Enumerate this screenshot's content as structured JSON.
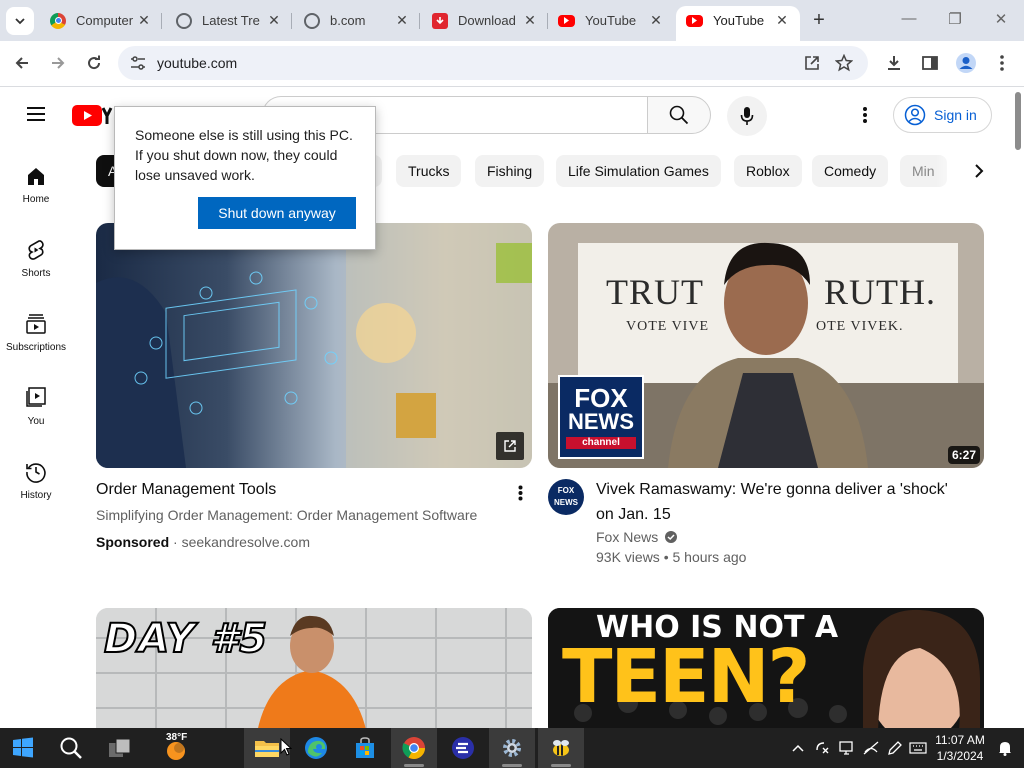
{
  "browser": {
    "tabs": [
      {
        "title": "Computer",
        "favicon": "chrome-icon",
        "active": false
      },
      {
        "title": "Latest Tre",
        "favicon": "globe-icon",
        "active": false
      },
      {
        "title": "b.com",
        "favicon": "globe-icon",
        "active": false
      },
      {
        "title": "Download",
        "favicon": "download-red-icon",
        "active": false
      },
      {
        "title": "YouTube",
        "favicon": "youtube-icon",
        "active": false
      },
      {
        "title": "YouTube",
        "favicon": "youtube-icon",
        "active": true
      }
    ],
    "url": "youtube.com"
  },
  "youtube": {
    "sign_in": "Sign in",
    "rail": [
      {
        "label": "Home",
        "icon": "home-icon"
      },
      {
        "label": "Shorts",
        "icon": "shorts-icon"
      },
      {
        "label": "Subscriptions",
        "icon": "subscriptions-icon"
      },
      {
        "label": "You",
        "icon": "you-icon"
      },
      {
        "label": "History",
        "icon": "history-icon"
      }
    ],
    "chips": [
      "A",
      "Trucks",
      "Fishing",
      "Life Simulation Games",
      "Roblox",
      "Comedy",
      "Min"
    ],
    "videos": [
      {
        "title": "Order Management Tools",
        "line2": "Simplifying Order Management: Order Management Software",
        "sponsored": "Sponsored",
        "domain": "seekandresolve.com"
      },
      {
        "title_line1": "Vivek Ramaswamy: We're gonna deliver a 'shock'",
        "title_line2": "on Jan. 15",
        "channel": "Fox News",
        "stats": "93K views • 5 hours ago",
        "duration": "6:27",
        "thumb_text_1": "TRUT",
        "thumb_text_2": "RUTH.",
        "thumb_vote_1": "VOTE VIVE",
        "thumb_vote_2": "OTE VIVEK.",
        "logo_line1": "FOX",
        "logo_line2": "NEWS",
        "logo_line3": "channel",
        "avatar_text": "FOX NEWS"
      },
      {
        "thumb_text": "DAY #5"
      },
      {
        "thumb_line1": "WHO IS NOT A",
        "thumb_line2": "TEEN?"
      }
    ]
  },
  "dialog": {
    "message": "Someone else is still using this PC. If you shut down now, they could lose unsaved work.",
    "button": "Shut down anyway"
  },
  "taskbar": {
    "weather": "38°F",
    "time": "11:07 AM",
    "date": "1/3/2024"
  },
  "colors": {
    "youtube_red": "#ff0000",
    "chrome_tabstrip": "#dfe3eb",
    "dialog_button": "#0067c0",
    "link_blue": "#065fd4",
    "taskbar": "#202020"
  }
}
